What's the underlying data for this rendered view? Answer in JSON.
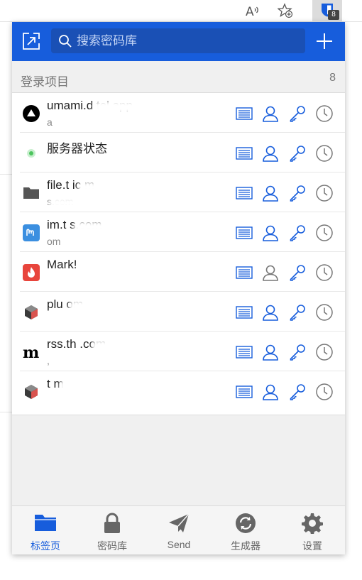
{
  "browser": {
    "extension_badge": "8",
    "icons": [
      "read-aloud-icon",
      "add-favorite-icon",
      "bitwarden-shield-icon"
    ]
  },
  "header": {
    "search": {
      "placeholder": "搜索密码库",
      "value": ""
    },
    "icons": [
      "popout-icon",
      "search-icon",
      "add-icon"
    ],
    "color": "#175ddc"
  },
  "section": {
    "title": "登录项目",
    "count": "8"
  },
  "items": [
    {
      "title": "umami.d        tel.app",
      "subtitle": "a",
      "favicon": "umami-triangle-icon"
    },
    {
      "title": "服务器状态",
      "subtitle": "",
      "favicon": "status-green-dot-icon"
    },
    {
      "title": "file.t      ic      m",
      "subtitle": "         s.com",
      "favicon": "folder-icon"
    },
    {
      "title": "im.t         s.com",
      "subtitle": "           om",
      "favicon": "mastodon-icon"
    },
    {
      "title": "Mark!",
      "subtitle": "",
      "favicon": "flame-icon"
    },
    {
      "title": "plu                    om",
      "subtitle": "",
      "favicon": "cube-icon"
    },
    {
      "title": "rss.th           .com",
      "subtitle": ",",
      "favicon": "medium-m-icon"
    },
    {
      "title": "t                        m",
      "subtitle": "",
      "favicon": "cube-icon"
    }
  ],
  "row_actions": [
    "view-icon",
    "copy-username-icon",
    "copy-password-icon",
    "totp-clock-icon"
  ],
  "tabs": [
    {
      "label": "标签页",
      "icon": "folder-tab-icon",
      "active": true
    },
    {
      "label": "密码库",
      "icon": "lock-icon",
      "active": false
    },
    {
      "label": "Send",
      "icon": "send-icon",
      "active": false
    },
    {
      "label": "生成器",
      "icon": "refresh-icon",
      "active": false
    },
    {
      "label": "设置",
      "icon": "gear-icon",
      "active": false
    }
  ],
  "colors": {
    "accent": "#175ddc",
    "action_icon": "#175ddc",
    "disabled_icon": "#777777"
  }
}
